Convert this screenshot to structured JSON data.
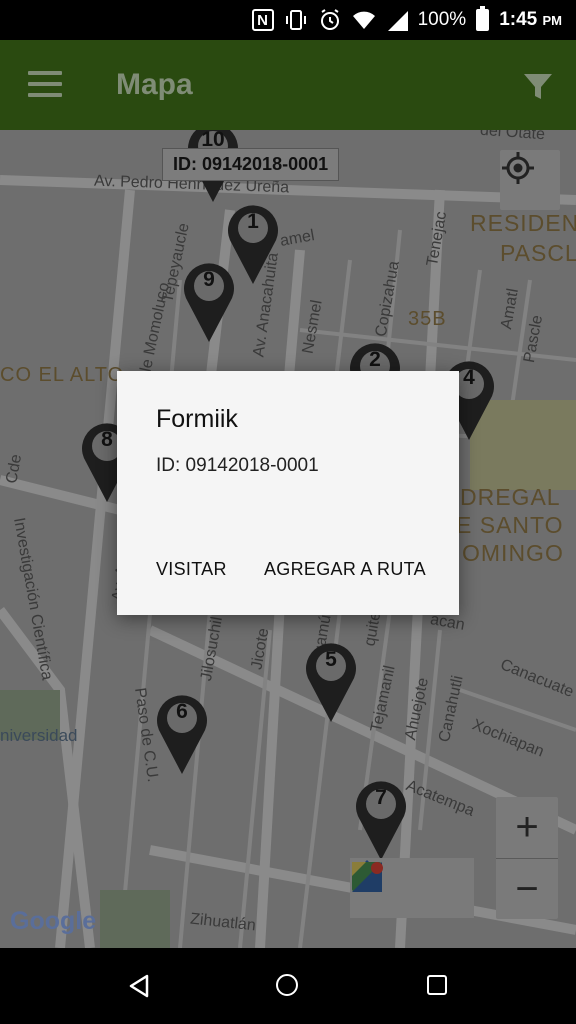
{
  "status_bar": {
    "nfc": "N",
    "battery_percent": "100%",
    "time": "1:45",
    "ampm": "PM"
  },
  "app_bar": {
    "title": "Mapa",
    "icons": [
      "menu-icon",
      "filter-icon"
    ]
  },
  "map": {
    "tooltip": "ID: 09142018-0001",
    "streets": [
      "Av. Pedro Henríquez Ureña",
      "Calle Momoluco",
      "Tepeyaucle",
      "Av. Anacahuita",
      "Nesmel",
      "Copizahua",
      "Tenejac",
      "Amatl",
      "Pascle",
      "Investigación Científica",
      "Av. Antonio Delfín",
      "Paso de C.U.",
      "Jilosuchil",
      "Jicote",
      "Tejamanil",
      "Ahuejote",
      "Canahutli",
      "Xochiapan",
      "Acatempa",
      "Canacuate",
      "Zihuatlán",
      "del Otate",
      "amel",
      "Guamúchil",
      "quite",
      "acan",
      "Cde"
    ],
    "areas": [
      "RESIDENC",
      "PASCL",
      "35B",
      "CO EL ALTO",
      "DREGAL",
      "E SANTO",
      "OMINGO",
      "niversidad"
    ],
    "markers": [
      "10",
      "1",
      "9",
      "2",
      "4",
      "8",
      "5",
      "6",
      "7"
    ],
    "google_logo": "Google",
    "controls": {
      "zoom_in": "+",
      "zoom_out": "−"
    }
  },
  "dialog": {
    "title": "Formiik",
    "message": "ID: 09142018-0001",
    "buttons": {
      "visit": "VISITAR",
      "add_route": "AGREGAR A RUTA"
    }
  },
  "colors": {
    "app_bar": "#2a4a10",
    "map_dimmed": "#6e6e6e",
    "dialog_bg": "#f5f5f5"
  }
}
